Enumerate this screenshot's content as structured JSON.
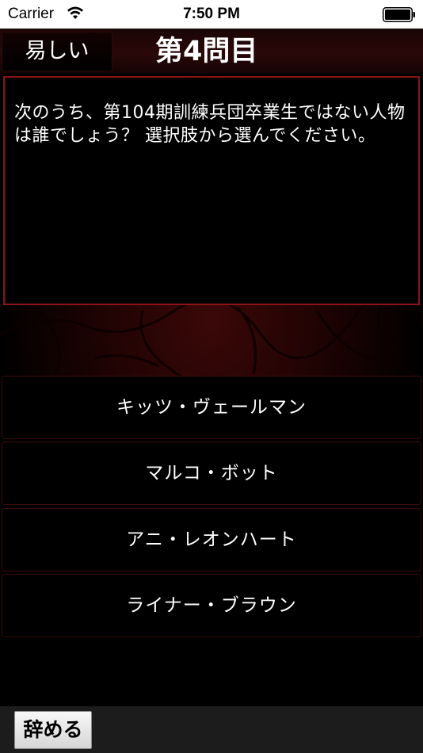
{
  "status_bar": {
    "carrier": "Carrier",
    "time": "7:50 PM",
    "wifi_icon": "wifi-icon",
    "battery_icon": "battery-icon"
  },
  "header": {
    "difficulty_label": "易しい",
    "question_number": "第4問目"
  },
  "question": {
    "text": "次のうち、第104期訓練兵団卒業生ではない人物は誰でしょう？ 選択肢から選んでください。"
  },
  "answers": [
    {
      "label": "キッツ・ヴェールマン"
    },
    {
      "label": "マルコ・ボット"
    },
    {
      "label": "アニ・レオンハート"
    },
    {
      "label": "ライナー・ブラウン"
    }
  ],
  "footer": {
    "quit_label": "辞める"
  },
  "colors": {
    "question_border": "#8e1414",
    "answer_border": "#3e0a0a",
    "background": "#000000"
  }
}
